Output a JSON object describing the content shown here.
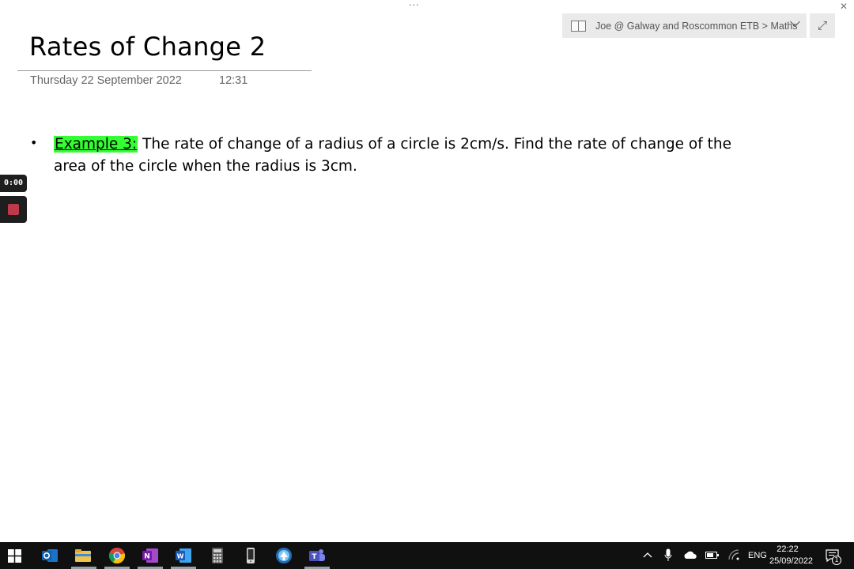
{
  "window": {
    "more_dots": "···",
    "close_glyph": "✕"
  },
  "breadcrumb": {
    "text": "Joe @ Galway and Roscommon ETB > Maths",
    "expand_glyph": "⤢"
  },
  "page": {
    "title": "Rates of Change 2",
    "date": "Thursday 22 September 2022",
    "time": "12:31"
  },
  "content": {
    "bullet": "•",
    "label": "Example 3:",
    "text": " The rate of change of a radius of a circle is 2cm/s. Find the rate of change of the area of the circle when the radius is 3cm."
  },
  "recorder": {
    "elapsed": "0:00"
  },
  "taskbar": {
    "apps": [
      "windows-start",
      "outlook",
      "file-explorer",
      "chrome",
      "onenote",
      "word",
      "calculator",
      "phone",
      "remote-desktop",
      "teams"
    ],
    "tray_language": "ENG",
    "clock_time": "22:22",
    "clock_date": "25/09/2022",
    "notification_count": "1"
  },
  "colors": {
    "highlight": "#33ff33",
    "crumb_bg": "#eaeaea",
    "taskbar_bg": "#101010",
    "record_red": "#c0394b"
  }
}
